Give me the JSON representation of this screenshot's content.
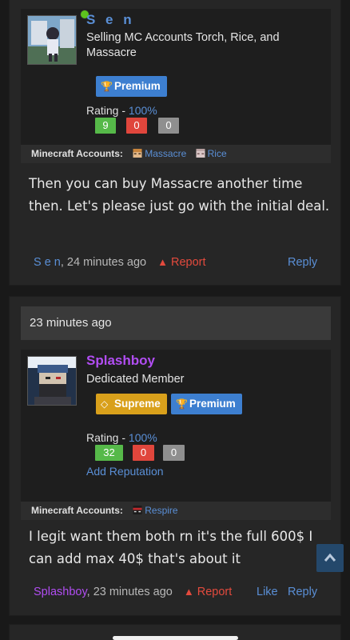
{
  "post1": {
    "author": {
      "name": "S e n",
      "title": "Selling MC Accounts Torch, Rice, and Massacre",
      "online": true,
      "badges": [
        {
          "label": "Premium",
          "icon": "trophy-icon",
          "color": "#3d7fd0"
        }
      ],
      "rating_label": "Rating - ",
      "rating_percent": "100%",
      "rating_positive": "9",
      "rating_negative": "0",
      "rating_neutral": "0",
      "accounts_label": "Minecraft Accounts:",
      "accounts": [
        "Massacre",
        "Rice"
      ]
    },
    "message": "Then you can buy Massacre another time then. Let's please just go with the initial deal.",
    "footer": {
      "author": "S e n",
      "time": ", 24 minutes ago",
      "report": "Report",
      "reply": "Reply"
    }
  },
  "post2": {
    "timestamp": "23 minutes ago",
    "author": {
      "name": "Splashboy",
      "title": "Dedicated Member",
      "badges": [
        {
          "label": "Supreme",
          "icon": "diamond-icon",
          "color": "#d9a01b"
        },
        {
          "label": "Premium",
          "icon": "trophy-icon",
          "color": "#3d7fd0"
        }
      ],
      "rating_label": "Rating - ",
      "rating_percent": "100%",
      "rating_positive": "32",
      "rating_negative": "0",
      "rating_neutral": "0",
      "add_reputation": "Add Reputation",
      "accounts_label": "Minecraft Accounts:",
      "accounts": [
        "Respire"
      ]
    },
    "message": "I legit want them both rn it's the full 600$ I can add max 40$ that's about it",
    "footer": {
      "author": "Splashboy",
      "time": ", 23 minutes ago",
      "report": "Report",
      "like": "Like",
      "reply": "Reply"
    }
  },
  "colors": {
    "link": "#5a8fd6",
    "splashboy_name": "#b14df2",
    "report": "#e34a3d",
    "online": "#5dc21e"
  }
}
